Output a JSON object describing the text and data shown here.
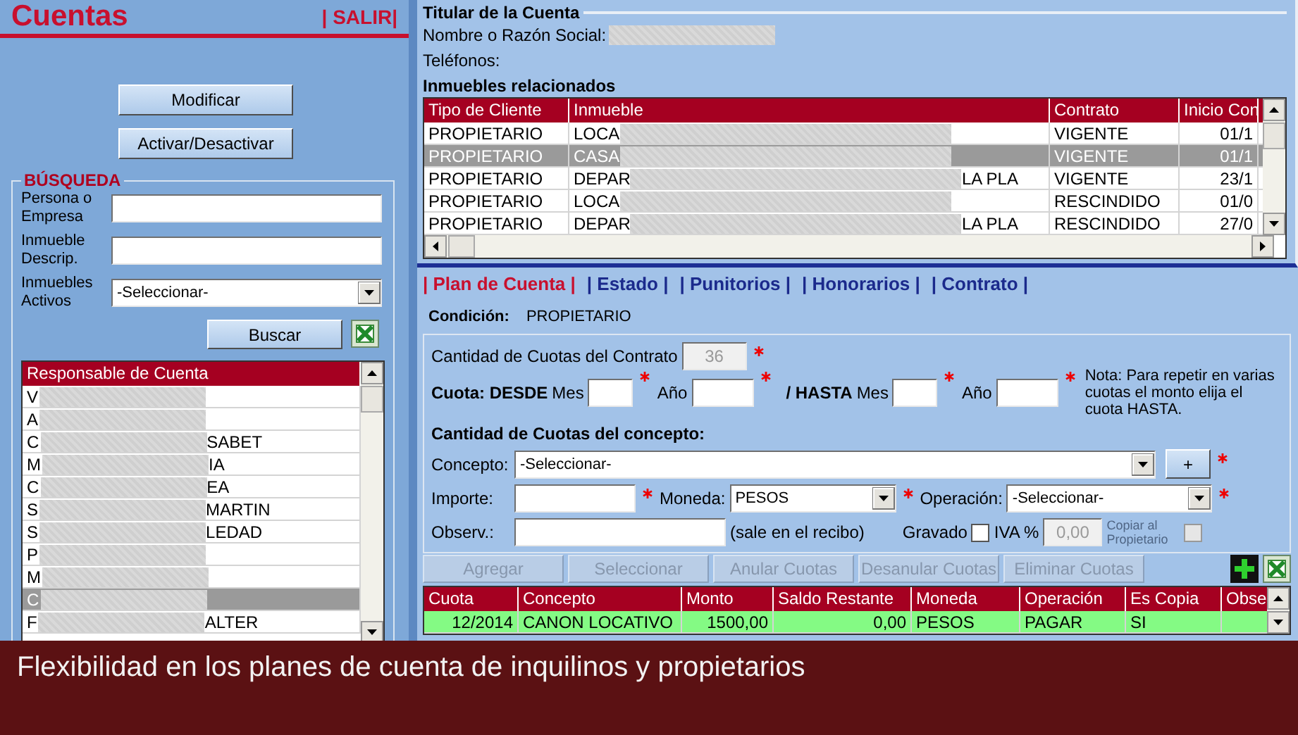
{
  "left_panel": {
    "title": "Cuentas",
    "exit_link": "| SALIR|",
    "buttons": [
      "Modificar",
      "Activar/Desactivar"
    ],
    "search": {
      "title": "BÚSQUEDA",
      "fields": [
        {
          "kind": "text",
          "label": "Persona o Empresa"
        },
        {
          "kind": "text",
          "label": "Inmueble Descrip."
        },
        {
          "kind": "select",
          "label": "Inmuebles Activos",
          "value": "-Seleccionar-"
        }
      ],
      "button": "Buscar"
    },
    "accounts_list": {
      "column": "Responsable de Cuenta",
      "rows": [
        {
          "lead": "V",
          "selected": false
        },
        {
          "lead": "A",
          "selected": false
        },
        {
          "lead": "C",
          "tail": "SABET",
          "selected": false
        },
        {
          "lead": "M",
          "tail": "IA",
          "selected": false
        },
        {
          "lead": "C",
          "tail": "EA",
          "selected": false
        },
        {
          "lead": "S",
          "tail": "MARTIN",
          "selected": false
        },
        {
          "lead": "S",
          "tail": "LEDAD",
          "selected": false
        },
        {
          "lead": "P",
          "selected": false
        },
        {
          "lead": "M",
          "selected": false
        },
        {
          "lead": "C",
          "selected": true
        },
        {
          "lead": "F",
          "tail": "ALTER",
          "selected": false
        }
      ]
    }
  },
  "holder": {
    "title": "Titular de la Cuenta",
    "name_label": "Nombre o Razón Social:",
    "phones_label": "Teléfonos:",
    "properties": {
      "title": "Inmuebles relacionados",
      "columns": [
        "Tipo de Cliente",
        "Inmueble",
        "Contrato",
        "Inicio Con"
      ],
      "rows": [
        {
          "cells": [
            "PROPIETARIO",
            {
              "lead": "LOCA"
            },
            "VIGENTE",
            "01/1"
          ],
          "selected": false
        },
        {
          "cells": [
            "PROPIETARIO",
            {
              "lead": "CASA"
            },
            "VIGENTE",
            "01/1"
          ],
          "selected": true
        },
        {
          "cells": [
            "PROPIETARIO",
            {
              "lead": "DEPAR",
              "tail": "LA PLA"
            },
            "VIGENTE",
            "23/1"
          ],
          "selected": false
        },
        {
          "cells": [
            "PROPIETARIO",
            {
              "lead": "LOCA"
            },
            "RESCINDIDO",
            "01/0"
          ],
          "selected": false
        },
        {
          "cells": [
            "PROPIETARIO",
            {
              "lead": "DEPAR",
              "tail": "LA PLA"
            },
            "RESCINDIDO",
            "27/0"
          ],
          "selected": false
        }
      ]
    }
  },
  "tabs": [
    {
      "label": "| Plan de Cuenta |",
      "selected": true
    },
    {
      "label": "| Estado |",
      "selected": false
    },
    {
      "label": "| Punitorios |",
      "selected": false
    },
    {
      "label": "| Honorarios |",
      "selected": false
    },
    {
      "label": "| Contrato |",
      "selected": false
    }
  ],
  "condition": {
    "label": "Condición:",
    "value": "PROPIETARIO"
  },
  "plan_form": {
    "contract_quotas": {
      "label": "Cantidad de Cuotas del Contrato",
      "value": "36",
      "disabled": true,
      "required": true
    },
    "range": {
      "from_label": "Cuota: DESDE",
      "to_label": "/ HASTA",
      "fields": [
        {
          "label": "Mes",
          "required": true
        },
        {
          "label": "Año",
          "required": true
        },
        {
          "label": "Mes",
          "required": true
        },
        {
          "label": "Año",
          "required": true
        }
      ],
      "note": "Nota: Para repetir en varias cuotas el monto elija el cuota HASTA."
    },
    "concept_title": "Cantidad de Cuotas del concepto:",
    "concept": {
      "label": "Concepto:",
      "value": "-Seleccionar-",
      "add_button": "+",
      "required": true
    },
    "amount": {
      "label": "Importe:",
      "required": true
    },
    "currency": {
      "label": "Moneda:",
      "value": "PESOS",
      "required": true
    },
    "operation": {
      "label": "Operación:",
      "value": "-Seleccionar-",
      "required": true
    },
    "notes": {
      "label": "Observ.:",
      "hint": "(sale en el recibo)"
    },
    "taxed": {
      "label": "Gravado",
      "checked": false
    },
    "vat": {
      "label": "IVA %",
      "value": "0,00",
      "disabled": true
    },
    "copy_owner": {
      "label": "Copiar al Propietario",
      "checked": false,
      "disabled": true
    }
  },
  "installments": {
    "buttons": [
      {
        "label": "Agregar",
        "disabled": true
      },
      {
        "label": "Seleccionar",
        "disabled": true
      },
      {
        "label": "Anular Cuotas",
        "disabled": true
      },
      {
        "label": "Desanular Cuotas",
        "disabled": true
      },
      {
        "label": "Eliminar Cuotas",
        "disabled": true
      }
    ],
    "columns": [
      "Cuota",
      "Concepto",
      "Monto",
      "Saldo Restante",
      "Moneda",
      "Operación",
      "Es Copia",
      "Obse"
    ],
    "rows": [
      {
        "cells": [
          "12/2014",
          "CANON LOCATIVO",
          "1500,00",
          "0,00",
          "PESOS",
          "PAGAR",
          "SI"
        ]
      }
    ]
  },
  "caption": "Flexibilidad en los planes de cuenta de inquilinos y propietarios"
}
